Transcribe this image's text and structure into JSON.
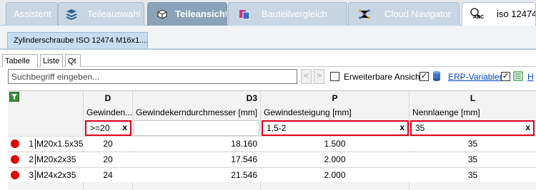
{
  "top_tabs": [
    {
      "label": "Assistent",
      "icon": "none"
    },
    {
      "label": "Teileauswahl",
      "icon": "catalog-icon"
    },
    {
      "label": "Teileansicht",
      "icon": "parts-view-icon"
    },
    {
      "label": "Bauteilvergleich",
      "icon": "compare-icon"
    },
    {
      "label": "Cloud Navigator",
      "icon": "cloud-navigator-icon"
    }
  ],
  "search_tab": {
    "icon_text": "ABC",
    "label": "iso 12474"
  },
  "doc_tab": {
    "label": "Zylinderschraube ISO 12474 M16x1...."
  },
  "sub_tabs": [
    "Tabelle",
    "Liste",
    "Qt"
  ],
  "toolbar": {
    "search_placeholder": "Suchbegriff eingeben...",
    "prev": "<",
    "next": ">",
    "expandable_label": "Erweiterbare Ansicht",
    "expandable_checked": false,
    "erp_checked": true,
    "erp_label": "ERP-Variablen",
    "third_checked": true,
    "third_label": "H",
    "check_mark": "✓"
  },
  "table": {
    "columns": [
      {
        "code": "D",
        "name": "Gewinden...",
        "filter": ">=20",
        "highlighted": true
      },
      {
        "code": "D3",
        "name": "Gewindekerndurchmesser [mm]",
        "filter": "",
        "highlighted": false
      },
      {
        "code": "P",
        "name": "Gewindesteigung [mm]",
        "filter": "1,5-2",
        "highlighted": true
      },
      {
        "code": "L",
        "name": "Nennlaenge [mm]",
        "filter": "35",
        "highlighted": true
      }
    ],
    "clear_symbol": "x",
    "rows": [
      {
        "index": "1",
        "name": "M20x1.5x35",
        "D": "20",
        "D3": "18.160",
        "P": "1.500",
        "L": "35"
      },
      {
        "index": "2",
        "name": "M20x2x35",
        "D": "20",
        "D3": "17.546",
        "P": "2.000",
        "L": "35"
      },
      {
        "index": "3",
        "name": "M24x2x35",
        "D": "24",
        "D3": "21.546",
        "P": "2.000",
        "L": "35"
      }
    ]
  },
  "colors": {
    "highlight": "#e3001b",
    "status_dot": "#e40000",
    "link": "#0044cc",
    "active_tab": "#8aa3b8"
  }
}
